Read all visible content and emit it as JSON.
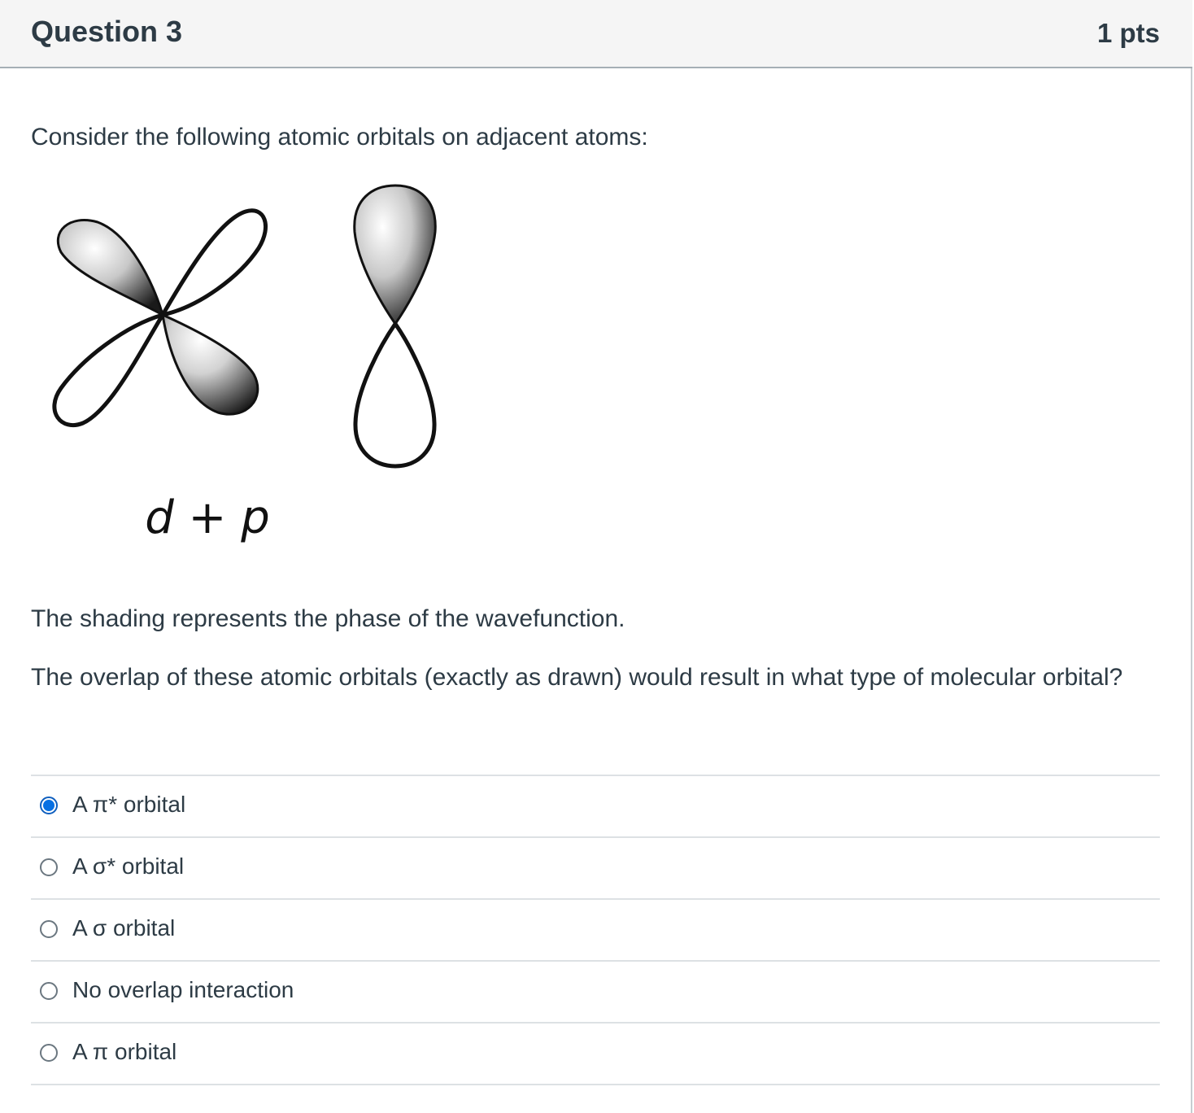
{
  "question": {
    "title": "Question 3",
    "points": "1 pts",
    "intro": "Consider the following atomic orbitals on adjacent atoms:",
    "figure_label": "d + p",
    "shading_note": "The shading represents the phase of the wavefunction.",
    "prompt": "The overlap of these atomic orbitals (exactly as drawn) would result in what type of molecular orbital?"
  },
  "answers": [
    {
      "label": "A π* orbital",
      "selected": true
    },
    {
      "label": "A σ* orbital",
      "selected": false
    },
    {
      "label": "A σ orbital",
      "selected": false
    },
    {
      "label": "No overlap interaction",
      "selected": false
    },
    {
      "label": "A π orbital",
      "selected": false
    }
  ],
  "colors": {
    "selected_radio": "#0770e3",
    "text": "#2d3b45",
    "header_bg": "#f5f5f5"
  }
}
